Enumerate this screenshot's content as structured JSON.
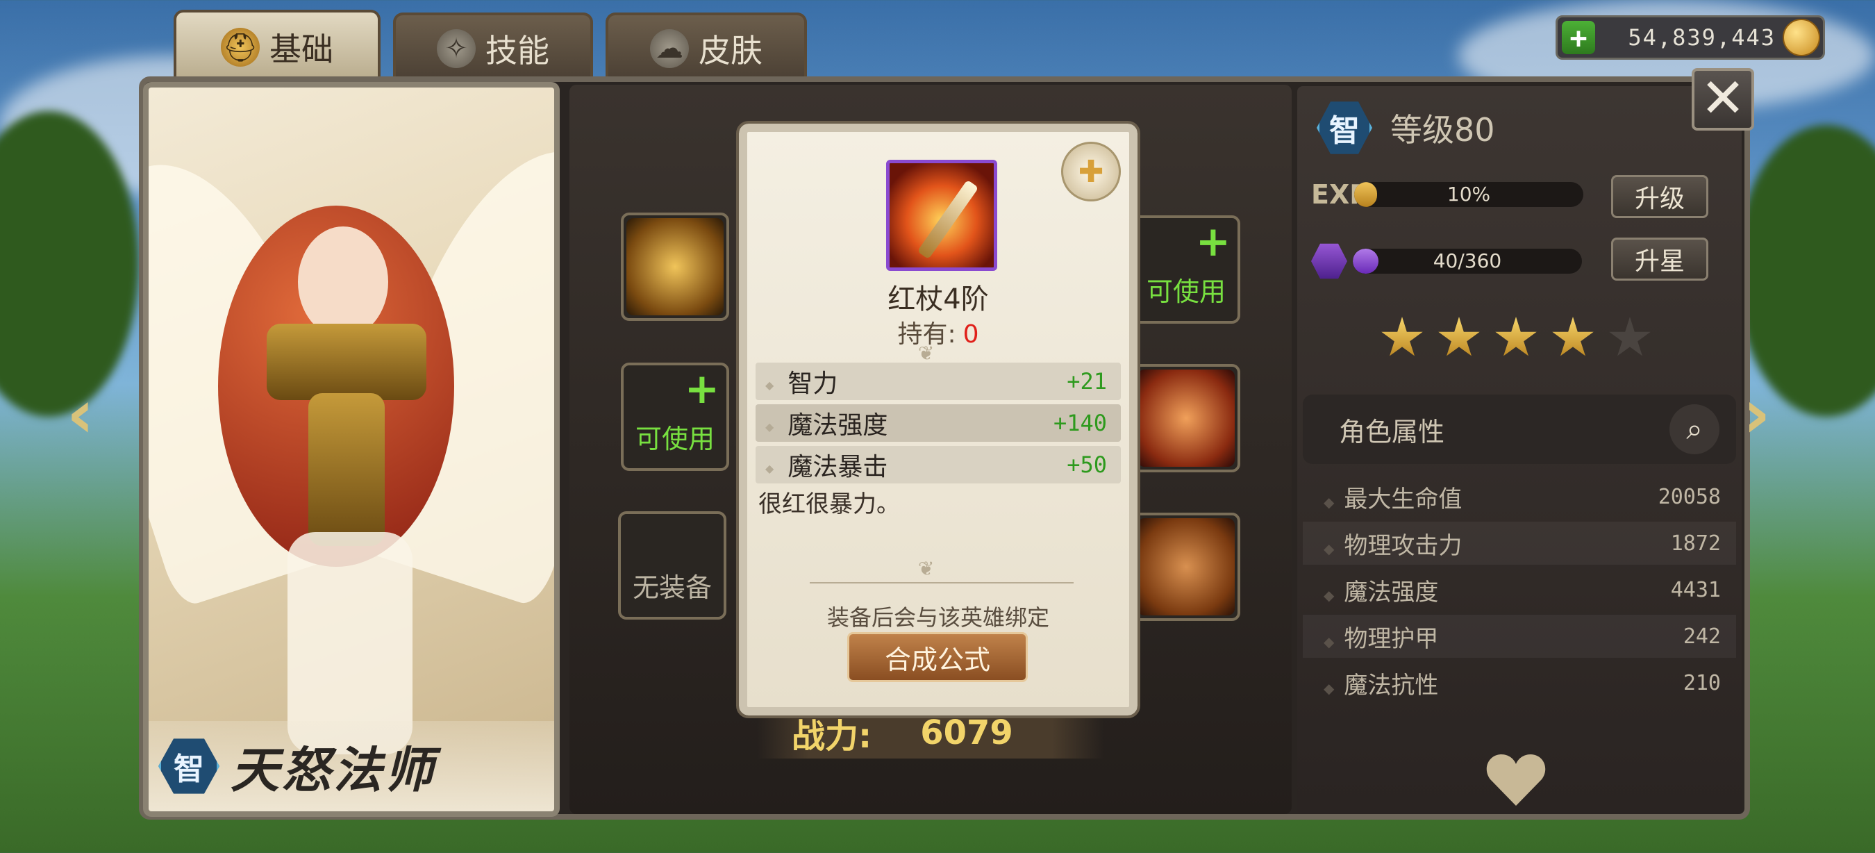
{
  "tabs": [
    {
      "label": "基础",
      "icon": "helmet-icon",
      "active": true
    },
    {
      "label": "技能",
      "icon": "skill-icon",
      "active": false
    },
    {
      "label": "皮肤",
      "icon": "skin-icon",
      "active": false
    }
  ],
  "currency": {
    "amount": "54,839,443",
    "icon": "gold-coin-icon"
  },
  "hero": {
    "class_badge": "智",
    "name": "天怒法师"
  },
  "slots": {
    "left_top": {
      "icon": "staff-icon"
    },
    "left_mid": {
      "label": "可使用",
      "icon": "plus-icon"
    },
    "left_bot": {
      "label": "无装备"
    },
    "right_top": {
      "label": "可使用",
      "icon": "plus-icon"
    },
    "right_mid": {
      "icon": "blade-icon"
    },
    "right_bot": {
      "icon": "boot-icon"
    }
  },
  "power": {
    "label": "战力:",
    "value": "6079"
  },
  "right_panel": {
    "class_badge": "智",
    "level": "等级80",
    "exp_label": "EXP",
    "exp_value": "10%",
    "exp_fill": 0.1,
    "shard_value": "40/360",
    "shard_fill": 0.111,
    "upgrade_btn": "升级",
    "star_btn": "升星",
    "stars_on": 4,
    "stars_total": 5,
    "attr_title": "角色属性",
    "attributes": [
      {
        "name": "最大生命值",
        "value": "20058"
      },
      {
        "name": "物理攻击力",
        "value": "1872"
      },
      {
        "name": "魔法强度",
        "value": "4431"
      },
      {
        "name": "物理护甲",
        "value": "242"
      },
      {
        "name": "魔法抗性",
        "value": "210"
      }
    ]
  },
  "popup": {
    "item_name": "红杖4阶",
    "owned_label": "持有:",
    "owned_value": "0",
    "stats": [
      {
        "name": "智力",
        "value": "+21"
      },
      {
        "name": "魔法强度",
        "value": "+140"
      },
      {
        "name": "魔法暴击",
        "value": "+50"
      }
    ],
    "description": "很红很暴力。",
    "bind_note": "装备后会与该英雄绑定",
    "craft_button": "合成公式"
  },
  "colors": {
    "accent_green": "#78e040",
    "stat_green": "#2e9a1e",
    "owned_red": "#e0201a",
    "gold": "#f2d46a"
  }
}
